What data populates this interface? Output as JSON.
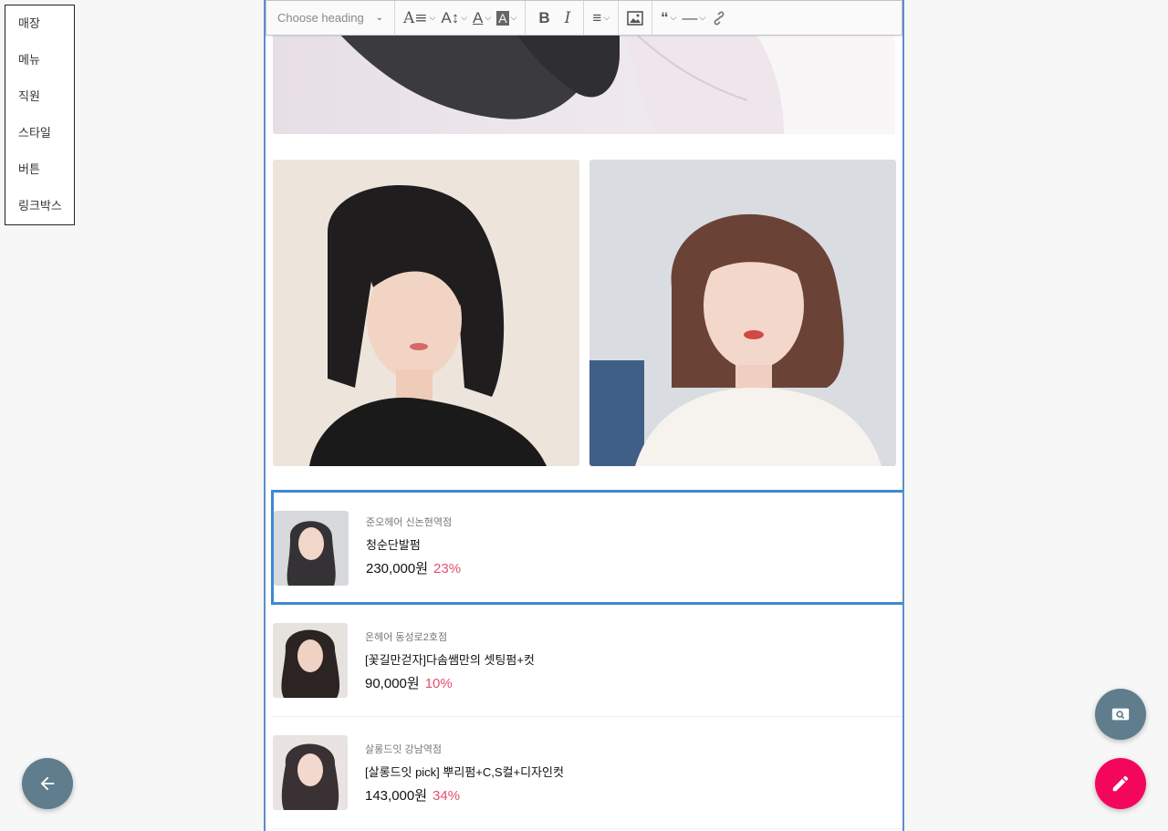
{
  "side_menu": {
    "items": [
      {
        "label": "매장"
      },
      {
        "label": "메뉴"
      },
      {
        "label": "직원"
      },
      {
        "label": "스타일"
      },
      {
        "label": "버튼"
      },
      {
        "label": "링크박스"
      }
    ]
  },
  "toolbar": {
    "heading_placeholder": "Choose heading",
    "icons": [
      "font-family-icon",
      "font-size-icon",
      "font-color-icon",
      "background-color-icon",
      "bold-icon",
      "italic-icon",
      "alignment-icon",
      "image-icon",
      "blockquote-icon",
      "horizontal-line-icon",
      "link-icon"
    ]
  },
  "products": [
    {
      "shop": "준오헤어 신논현역점",
      "title": "청순단발펌",
      "price": "230,000원",
      "discount": "23%"
    },
    {
      "shop": "온헤어 동성로2호점",
      "title": "[꽃길만걷자]다솜쌤만의 셋팅펌+컷",
      "price": "90,000원",
      "discount": "10%"
    },
    {
      "shop": "살롱드잇 강남역점",
      "title": "[살롱드잇 pick] 뿌리펌+C,S컬+디자인컷",
      "price": "143,000원",
      "discount": "34%"
    }
  ],
  "colors": {
    "accent_blue": "#3d89d3",
    "discount_pink": "#e44f6d",
    "fab_gray": "#5f7d8c",
    "fab_pink": "#f4065b"
  },
  "fabs": {
    "back": "arrow-left-icon",
    "search": "image-search-icon",
    "edit": "pencil-icon"
  }
}
